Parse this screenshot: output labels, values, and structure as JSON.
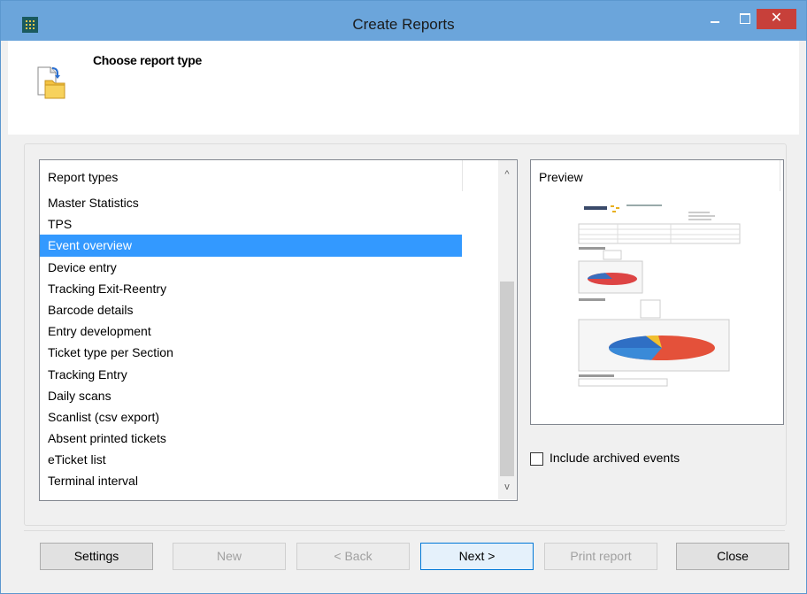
{
  "window": {
    "title": "Create Reports",
    "close_glyph": "✕",
    "icons": [
      "app-grid-icon",
      "minimize-icon",
      "maximize-icon",
      "close-icon"
    ]
  },
  "header": {
    "title": "Choose report type",
    "icon": "report-folder-icon"
  },
  "report_list": {
    "column_header": "Report types",
    "items": [
      "Master Statistics",
      "TPS",
      "Event overview",
      "Device entry",
      "Tracking Exit-Reentry",
      "Barcode details",
      "Entry development",
      "Ticket type per Section",
      "Tracking Entry",
      "Daily scans",
      "Scanlist (csv export)",
      "Absent printed tickets",
      "eTicket list",
      "Terminal interval"
    ],
    "selected_index": 2,
    "scroll_up_glyph": "^",
    "scroll_down_glyph": "v"
  },
  "preview": {
    "header": "Preview"
  },
  "options": {
    "include_archived_label": "Include archived events",
    "include_archived_checked": false
  },
  "buttons": {
    "settings": "Settings",
    "new": "New",
    "back": "< Back",
    "next": "Next >",
    "print_report": "Print report",
    "close": "Close"
  },
  "colors": {
    "titlebar": "#6ba5db",
    "selection": "#3399ff",
    "close_button": "#c7403a"
  }
}
